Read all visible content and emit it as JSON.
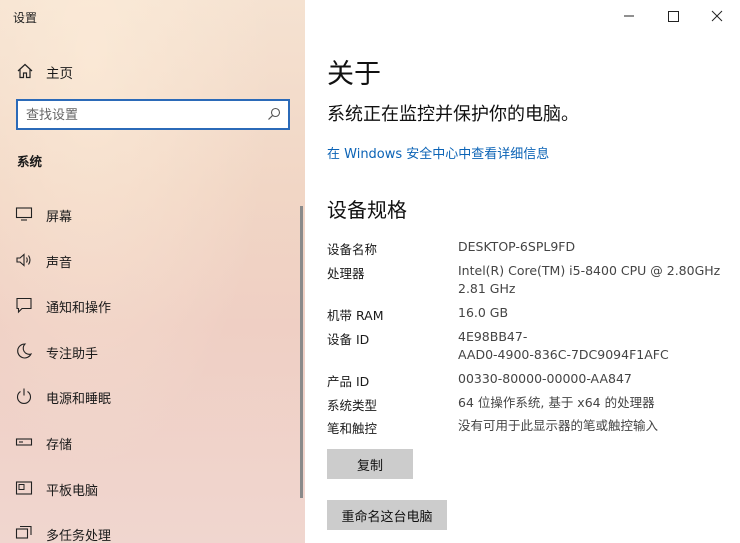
{
  "window": {
    "title": "设置"
  },
  "sidebar": {
    "home_label": "主页",
    "search": {
      "placeholder": "查找设置",
      "value": ""
    },
    "section_label": "系统",
    "items": [
      {
        "label": "屏幕",
        "icon": "monitor-icon"
      },
      {
        "label": "声音",
        "icon": "speaker-icon"
      },
      {
        "label": "通知和操作",
        "icon": "notification-icon"
      },
      {
        "label": "专注助手",
        "icon": "moon-icon"
      },
      {
        "label": "电源和睡眠",
        "icon": "power-icon"
      },
      {
        "label": "存储",
        "icon": "storage-icon"
      },
      {
        "label": "平板电脑",
        "icon": "tablet-icon"
      },
      {
        "label": "多任务处理",
        "icon": "multitask-icon"
      }
    ]
  },
  "main": {
    "title": "关于",
    "protect_text": "系统正在监控并保护你的电脑。",
    "security_link": "在 Windows 安全中心中查看详细信息",
    "specs_heading": "设备规格",
    "specs": [
      {
        "label": "设备名称",
        "value": "DESKTOP-6SPL9FD"
      },
      {
        "label": "处理器",
        "value": "Intel(R) Core(TM) i5-8400 CPU @ 2.80GHz",
        "value2": "2.81 GHz"
      },
      {
        "label": "机带 RAM",
        "value": "16.0 GB"
      },
      {
        "label": "设备 ID",
        "value": "4E98BB47-",
        "value2": "AAD0-4900-836C-7DC9094F1AFC"
      },
      {
        "label": "产品 ID",
        "value": "00330-80000-00000-AA847"
      },
      {
        "label": "系统类型",
        "value": "64 位操作系统, 基于 x64 的处理器"
      },
      {
        "label": "笔和触控",
        "value": "没有可用于此显示器的笔或触控输入"
      }
    ],
    "copy_button": "复制",
    "rename_button": "重命名这台电脑"
  },
  "colors": {
    "accent": "#2b6ab8",
    "link": "#0b63b6",
    "button_bg": "#cccccc"
  }
}
